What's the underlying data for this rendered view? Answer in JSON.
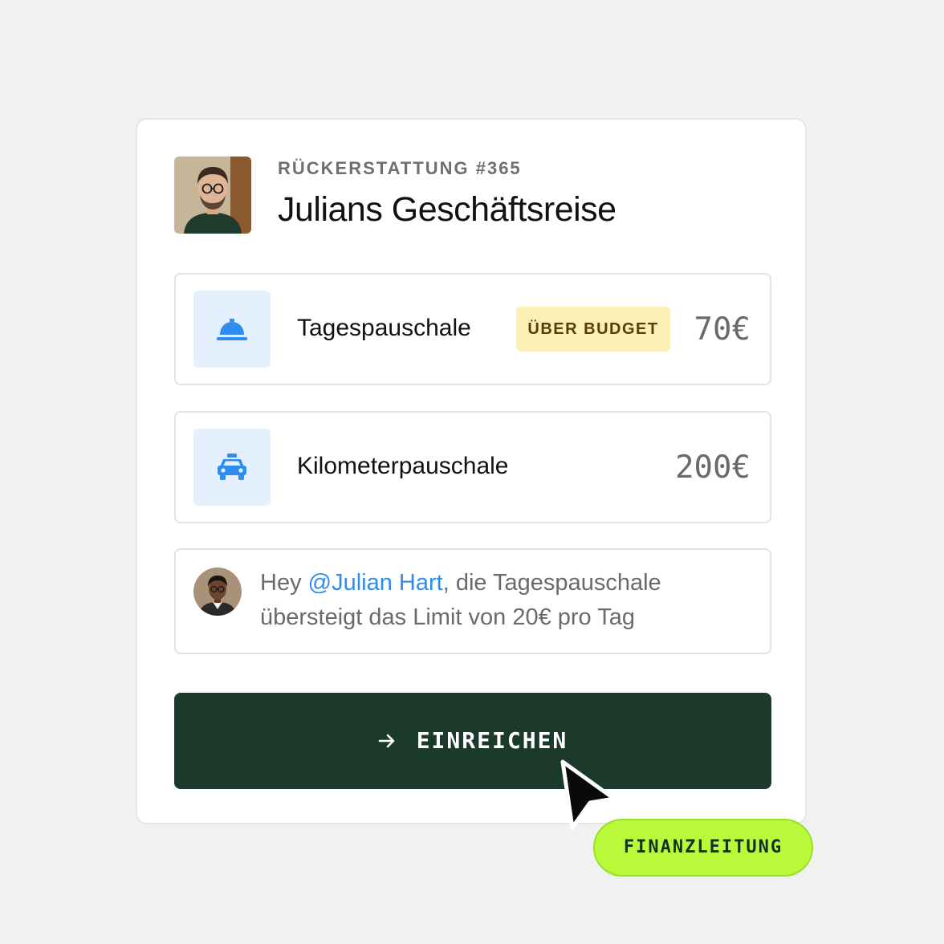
{
  "header": {
    "eyebrow": "RÜCKERSTATTUNG #365",
    "title": "Julians Geschäftsreise"
  },
  "items": [
    {
      "icon": "service-bell-icon",
      "label": "Tagespauschale",
      "badge": "ÜBER BUDGET",
      "amount": "70€"
    },
    {
      "icon": "taxi-icon",
      "label": "Kilometerpauschale",
      "amount": "200€"
    }
  ],
  "comment": {
    "prefix": "Hey ",
    "mention": "@Julian Hart",
    "suffix": ", die Tagespauschale übersteigt das Limit von 20€ pro Tag"
  },
  "submit": {
    "label": "EINREICHEN",
    "icon": "arrow-right-icon"
  },
  "role_tag": "FINANZLEITUNG",
  "colors": {
    "accent_blue": "#2f8cf0",
    "submit_bg": "#1c3a2b",
    "badge_bg": "#fcefb3",
    "role_tag_bg": "#b8fa3b"
  }
}
